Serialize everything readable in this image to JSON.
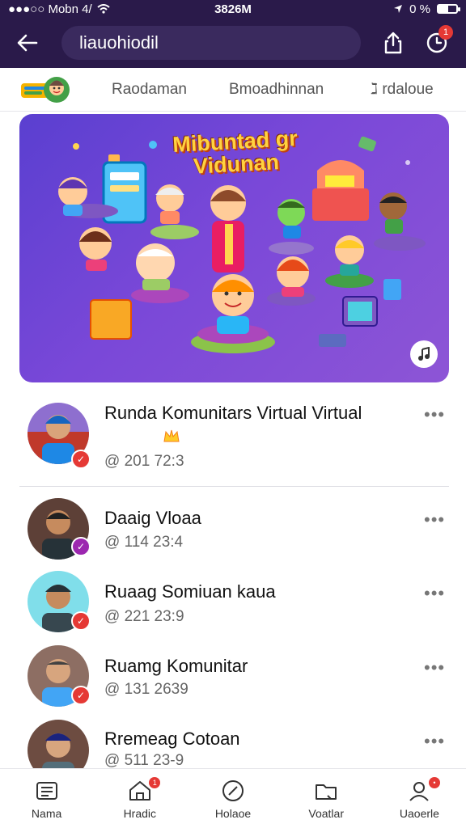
{
  "status_bar": {
    "carrier": "●●●○○ Mobn 4/",
    "time": "3826M",
    "battery": "0 %",
    "battery_level": 0.55
  },
  "app_bar": {
    "search_text": "liauohiodil",
    "notification_count": "1"
  },
  "tabs": [
    {
      "label": "Raodaman"
    },
    {
      "label": "Bmoadhinnan"
    },
    {
      "label": "ℷ rdaloue"
    }
  ],
  "hero": {
    "title_line1": "Mibuntad gr",
    "title_line2": "Vidunan"
  },
  "list": [
    {
      "title": "Runda Komunitars Virtual Virtual",
      "meta": "@ 201 72:3",
      "badge_color": "#e53935"
    },
    {
      "title": "Daaig Vloaa",
      "meta": "@ 114 23:4",
      "badge_color": "#9c27b0"
    },
    {
      "title": "Ruaag Somiuan kaua",
      "meta": "@ 221 23:9",
      "badge_color": "#e53935"
    },
    {
      "title": "Ruamg Komunitar",
      "meta": "@ 131 2639",
      "badge_color": "#e53935"
    },
    {
      "title": "Rremeag Cotoan",
      "meta": "@ 511 23-9",
      "badge_color": "#e53935"
    }
  ],
  "bottom_nav": [
    {
      "label": "Nama",
      "icon": "document-icon"
    },
    {
      "label": "Hradic",
      "icon": "home-icon",
      "badge": "1"
    },
    {
      "label": "Holaoe",
      "icon": "compass-icon"
    },
    {
      "label": "Voatlar",
      "icon": "folder-icon"
    },
    {
      "label": "Uaoerle",
      "icon": "profile-icon",
      "badge": "•"
    }
  ]
}
